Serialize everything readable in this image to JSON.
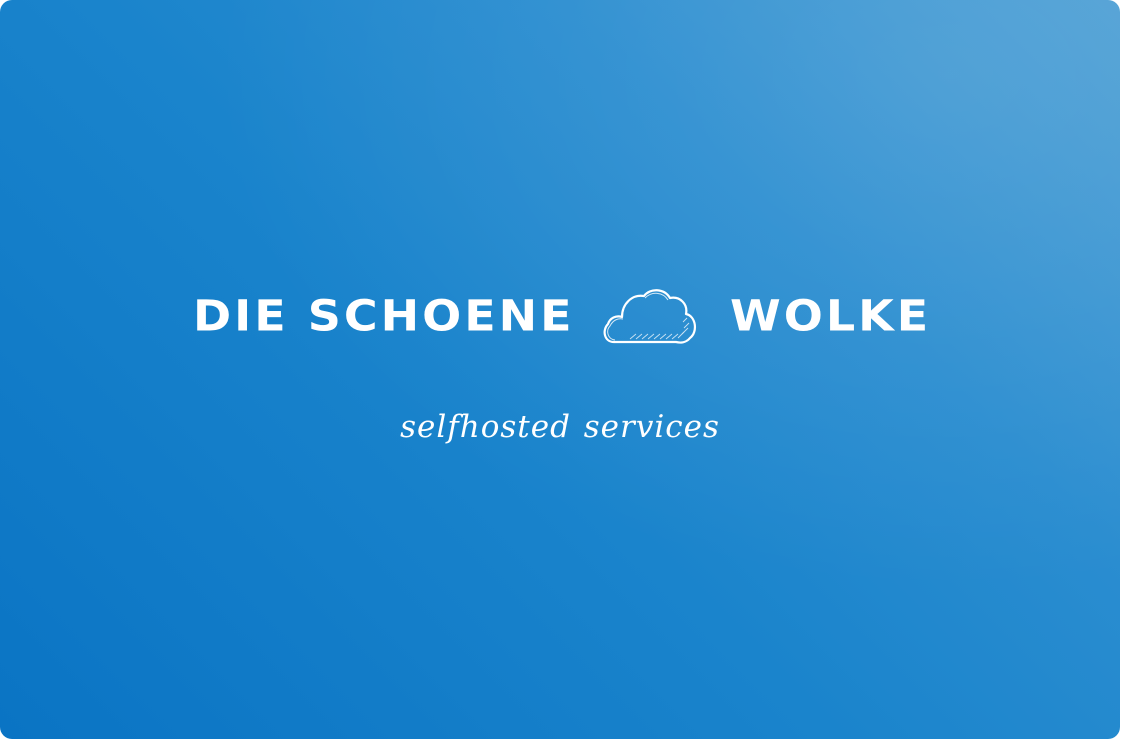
{
  "logo": {
    "word_left": "DIE SCHOENE",
    "word_right": "WOLKE",
    "icon": "cloud-icon"
  },
  "tagline": "selfhosted services",
  "colors": {
    "background_start": "#0a74c4",
    "background_end": "#4b9ed4",
    "text": "#ffffff"
  }
}
